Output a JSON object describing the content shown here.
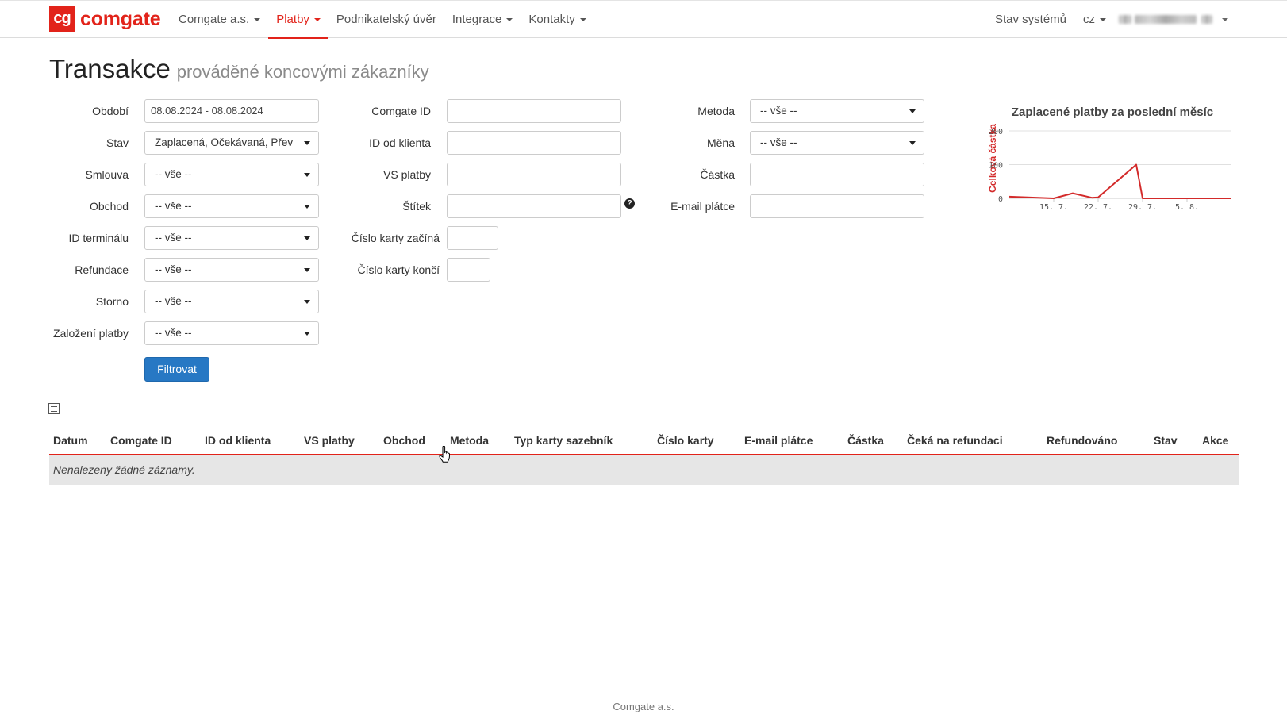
{
  "nav": {
    "logo_mark": "cg",
    "logo_text": "comgate",
    "items": [
      {
        "label": "Comgate a.s.",
        "dropdown": true
      },
      {
        "label": "Platby",
        "dropdown": true,
        "active": true
      },
      {
        "label": "Podnikatelský úvěr",
        "dropdown": false
      },
      {
        "label": "Integrace",
        "dropdown": true
      },
      {
        "label": "Kontakty",
        "dropdown": true
      }
    ],
    "status_link": "Stav systémů",
    "language": "cz"
  },
  "page": {
    "title": "Transakce",
    "subtitle": "prováděné koncovými zákazníky"
  },
  "filters": {
    "obdobi": {
      "label": "Období",
      "value": "08.08.2024 - 08.08.2024"
    },
    "stav": {
      "label": "Stav",
      "value": "Zaplacená, Očekávaná, Přev"
    },
    "smlouva": {
      "label": "Smlouva",
      "value": "-- vše --"
    },
    "obchod": {
      "label": "Obchod",
      "value": "-- vše --"
    },
    "id_terminalu": {
      "label": "ID terminálu",
      "value": "-- vše --"
    },
    "refundace": {
      "label": "Refundace",
      "value": "-- vše --"
    },
    "storno": {
      "label": "Storno",
      "value": "-- vše --"
    },
    "zalozeni": {
      "label": "Založení platby",
      "value": "-- vše --"
    },
    "comgate_id": {
      "label": "Comgate ID",
      "value": ""
    },
    "id_klienta": {
      "label": "ID od klienta",
      "value": ""
    },
    "vs_platby": {
      "label": "VS platby",
      "value": ""
    },
    "stitek": {
      "label": "Štítek",
      "value": "",
      "help": "?"
    },
    "karta_zacina": {
      "label": "Číslo karty začíná",
      "value": ""
    },
    "karta_konci": {
      "label": "Číslo karty končí",
      "value": ""
    },
    "metoda": {
      "label": "Metoda",
      "value": "-- vše --"
    },
    "mena": {
      "label": "Měna",
      "value": "-- vše --"
    },
    "castka": {
      "label": "Částka",
      "value": ""
    },
    "email": {
      "label": "E-mail plátce",
      "value": ""
    },
    "submit_label": "Filtrovat"
  },
  "chart_data": {
    "type": "line",
    "title": "Zaplacené platby za poslední měsíc",
    "ylabel": "Celková částka",
    "ylim": [
      0,
      200
    ],
    "yticks": [
      0,
      100,
      200
    ],
    "x": [
      0,
      7,
      10,
      13,
      14,
      20,
      21,
      28,
      35
    ],
    "values": [
      5,
      0,
      15,
      2,
      3,
      100,
      0,
      0,
      0
    ],
    "xlim": [
      0,
      35
    ],
    "xticks": [
      {
        "x": 7,
        "label": "15. 7."
      },
      {
        "x": 14,
        "label": "22. 7."
      },
      {
        "x": 21,
        "label": "29. 7."
      },
      {
        "x": 28,
        "label": "5. 8."
      }
    ],
    "series_color": "#d32a2a",
    "grid": true
  },
  "table": {
    "columns": [
      "Datum",
      "Comgate ID",
      "ID od klienta",
      "VS platby",
      "Obchod",
      "Metoda",
      "Typ karty sazebník",
      "Číslo karty",
      "E-mail plátce",
      "Částka",
      "Čeká na refundaci",
      "Refundováno",
      "Stav",
      "Akce"
    ],
    "empty_text": "Nenalezeny žádné záznamy."
  },
  "footer": {
    "text": "Comgate a.s."
  }
}
